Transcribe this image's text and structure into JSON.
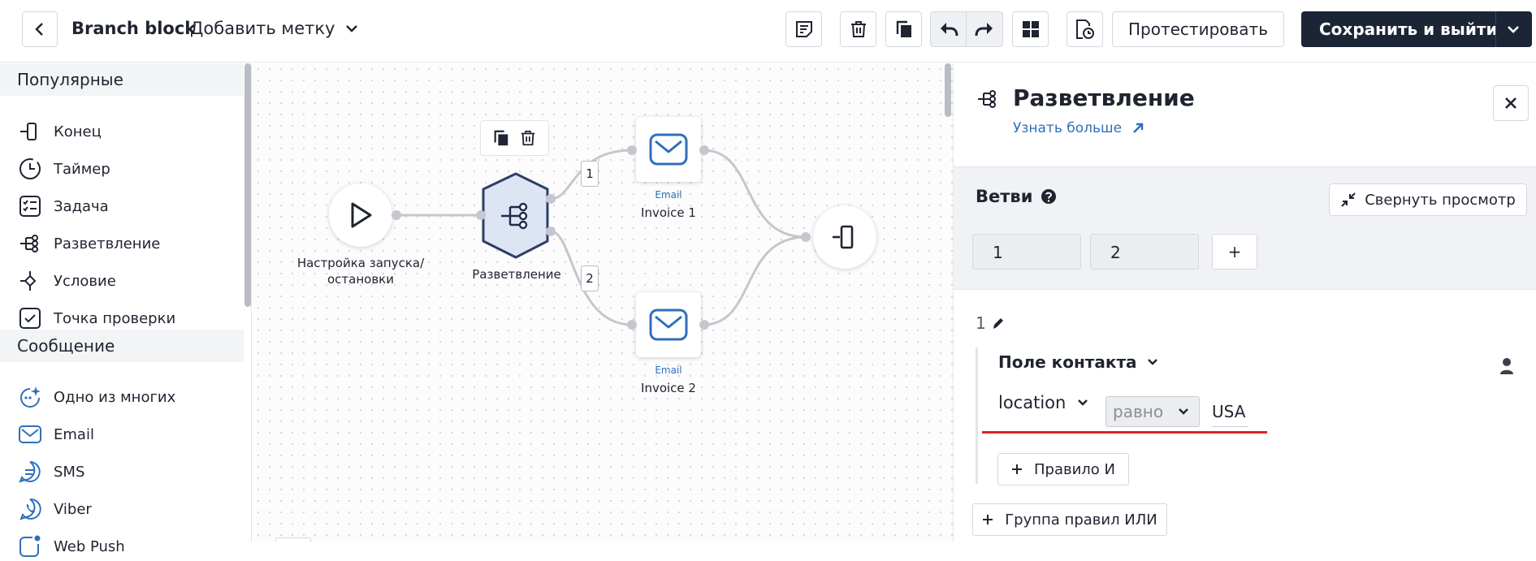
{
  "header": {
    "title": "Branch block",
    "add_label": "Добавить метку",
    "test_button": "Протестировать",
    "save_button": "Сохранить и выйти"
  },
  "sidebar": {
    "sections": [
      {
        "title": "Популярные",
        "items": [
          {
            "label": "Конец",
            "icon": "end-icon"
          },
          {
            "label": "Таймер",
            "icon": "timer-icon"
          },
          {
            "label": "Задача",
            "icon": "task-icon"
          },
          {
            "label": "Разветвление",
            "icon": "branch-icon"
          },
          {
            "label": "Условие",
            "icon": "condition-icon"
          },
          {
            "label": "Точка проверки",
            "icon": "checkpoint-icon"
          }
        ]
      },
      {
        "title": "Сообщение",
        "items": [
          {
            "label": "Одно из многих",
            "icon": "sparkle-message-icon"
          },
          {
            "label": "Email",
            "icon": "email-icon"
          },
          {
            "label": "SMS",
            "icon": "sms-icon"
          },
          {
            "label": "Viber",
            "icon": "viber-icon"
          },
          {
            "label": "Web Push",
            "icon": "web-push-icon"
          }
        ]
      }
    ]
  },
  "canvas": {
    "start_node_label": "Настройка запуска/остановки",
    "branch_node_label": "Разветвление",
    "edge_labels": [
      "1",
      "2"
    ],
    "email_nodes": [
      {
        "type": "Email",
        "name": "Invoice 1"
      },
      {
        "type": "Email",
        "name": "Invoice 2"
      }
    ]
  },
  "panel": {
    "title": "Разветвление",
    "learn_more": "Узнать больше",
    "branches_title": "Ветви",
    "collapse_button": "Свернуть просмотр",
    "branch_tabs": [
      "1",
      "2"
    ],
    "add_branch": "+",
    "branch_number": "1",
    "contact_field": "Поле контакта",
    "rule": {
      "attribute": "location",
      "operator": "равно",
      "value": "USA"
    },
    "and_rule": "Правило И",
    "or_group": "Группа правил ИЛИ"
  },
  "colors": {
    "accent": "#2f6fba",
    "primary_dark": "#1c2536",
    "highlight_red": "#d8232a",
    "branch_node_fill": "#dde5f4"
  }
}
